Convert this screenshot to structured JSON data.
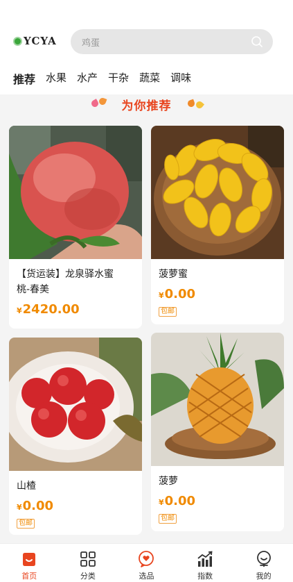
{
  "header": {
    "logo_text": "YCYA",
    "search_placeholder": "鸡蛋"
  },
  "tabs": [
    {
      "label": "推荐",
      "active": true
    },
    {
      "label": "水果",
      "active": false
    },
    {
      "label": "水产",
      "active": false
    },
    {
      "label": "干杂",
      "active": false
    },
    {
      "label": "蔬菜",
      "active": false
    },
    {
      "label": "调味",
      "active": false
    }
  ],
  "section": {
    "title": "为你推荐"
  },
  "products": [
    {
      "name_line1": "【货运装】龙泉驿水蜜",
      "name_line2": "桃-春美",
      "currency": "¥",
      "price": "2420.00",
      "tag": ""
    },
    {
      "name_line1": "菠萝蜜",
      "name_line2": "",
      "currency": "¥",
      "price": "0.00",
      "tag": "包邮"
    },
    {
      "name_line1": "山楂",
      "name_line2": "",
      "currency": "¥",
      "price": "0.00",
      "tag": "包邮"
    },
    {
      "name_line1": "菠萝",
      "name_line2": "",
      "currency": "¥",
      "price": "0.00",
      "tag": "包邮"
    }
  ],
  "bottom_nav": [
    {
      "label": "首页",
      "icon": "home-icon",
      "active": true
    },
    {
      "label": "分类",
      "icon": "grid-icon",
      "active": false
    },
    {
      "label": "选品",
      "icon": "heart-chat-icon",
      "active": false
    },
    {
      "label": "指数",
      "icon": "chart-icon",
      "active": false
    },
    {
      "label": "我的",
      "icon": "profile-icon",
      "active": false
    }
  ],
  "colors": {
    "accent": "#e8451f",
    "price": "#f08a00",
    "search_bg": "#e6e6e6",
    "page_bg": "#f4f4f4"
  }
}
